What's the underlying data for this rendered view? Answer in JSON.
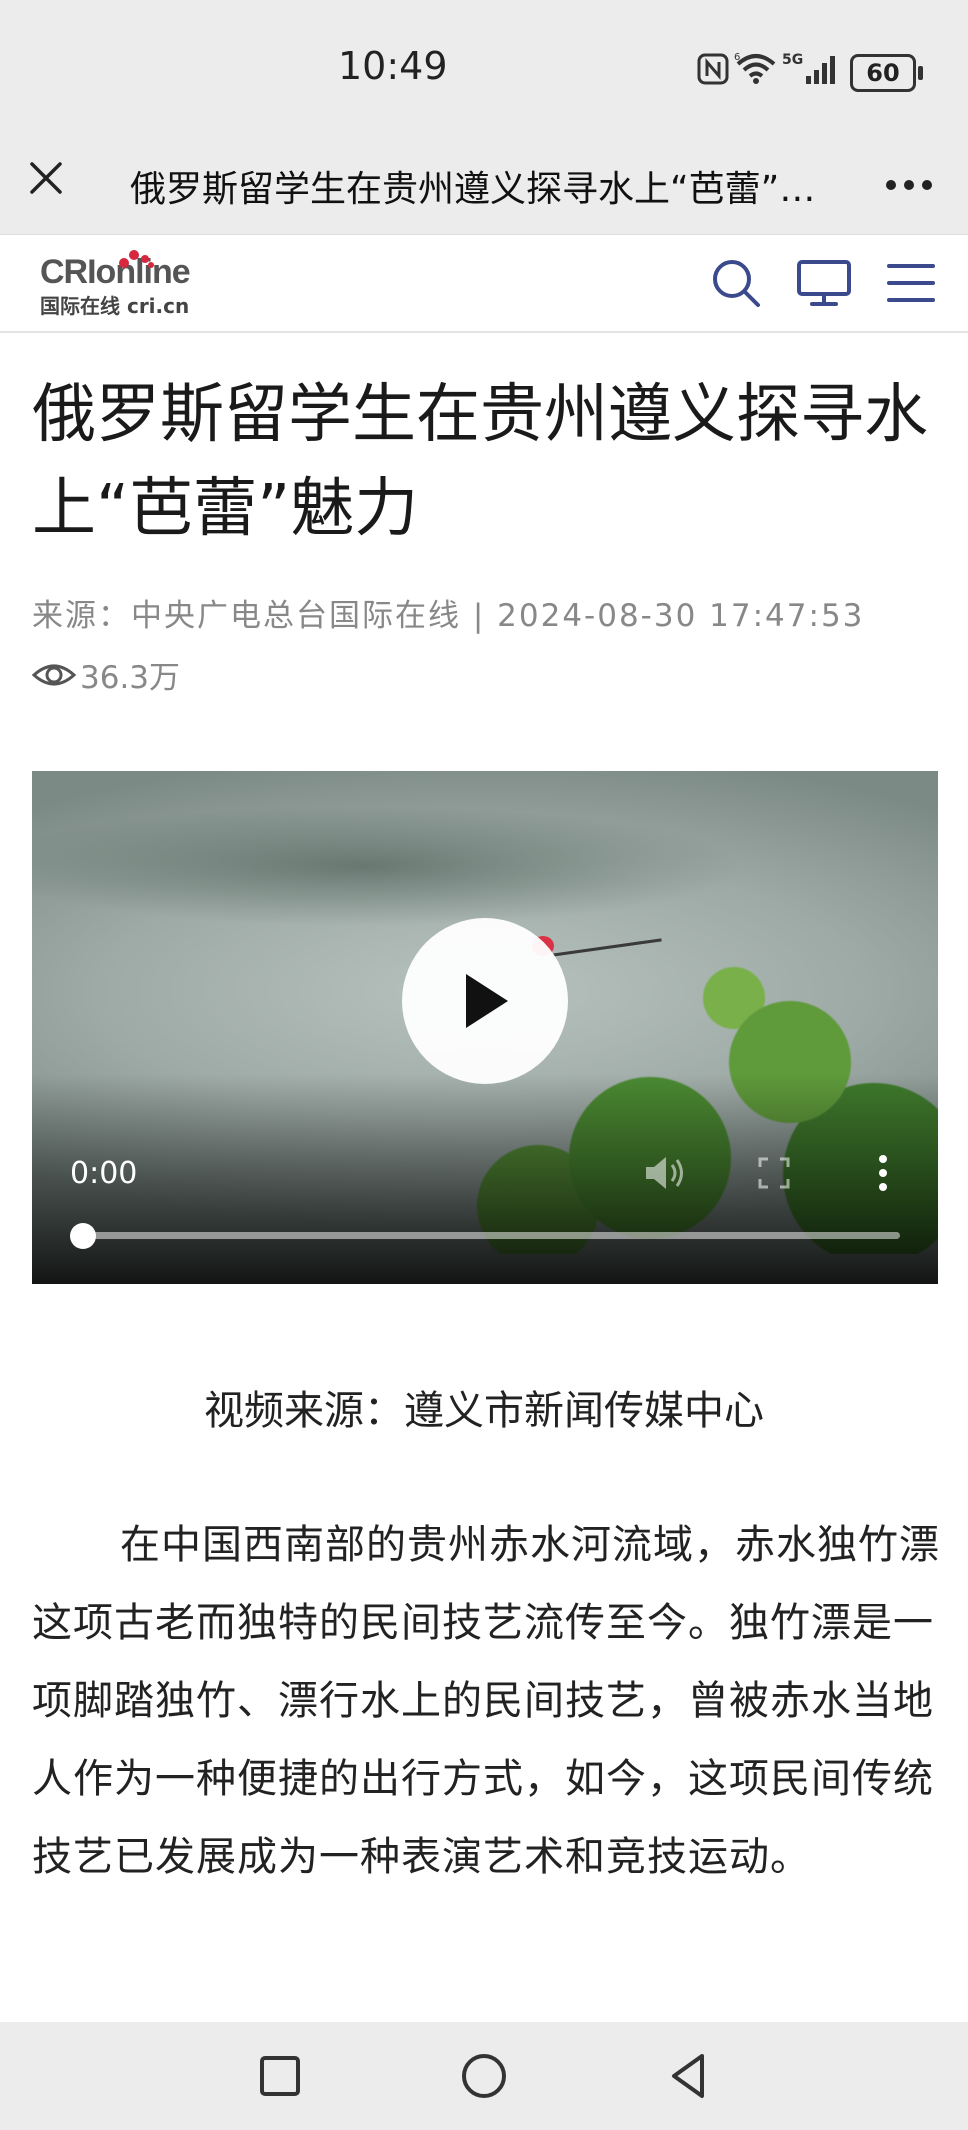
{
  "status_bar": {
    "time": "10:49",
    "battery": "60",
    "icons": [
      "nfc-icon",
      "wifi-icon",
      "5g-signal-icon",
      "battery-icon"
    ]
  },
  "title_bar": {
    "title": "俄罗斯留学生在贵州遵义探寻水上“芭蕾”魅力",
    "close_icon": "close-icon",
    "more_icon": "more-icon"
  },
  "site_header": {
    "logo_top": "CRIonline",
    "logo_bottom": "国际在线 cri.cn",
    "icons": [
      "search-icon",
      "tv-icon",
      "menu-icon"
    ],
    "accent": "#3a4a8c"
  },
  "article": {
    "headline": "俄罗斯留学生在贵州遵义探寻水上“芭蕾”魅力",
    "meta": "来源：中央广电总台国际在线  |  2024-08-30 17:47:53",
    "views": "36.3万",
    "video": {
      "current_time": "0:00",
      "progress": 0
    },
    "video_caption": "视频来源：遵义市新闻传媒中心",
    "paragraph": "在中国西南部的贵州赤水河流域，赤水独竹漂这项古老而独特的民间技艺流传至今。独竹漂是一项脚踏独竹、漂行水上的民间技艺，曾被赤水当地人作为一种便捷的出行方式，如今，这项民间传统技艺已发展成为一种表演艺术和竞技运动。"
  },
  "nav_bar": {
    "icons": [
      "recent-apps-icon",
      "home-icon",
      "back-icon"
    ]
  }
}
